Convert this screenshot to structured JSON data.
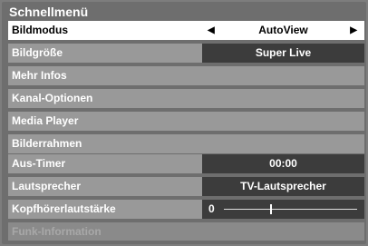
{
  "menu": {
    "title": "Schnellmenü",
    "rows": [
      {
        "label": "Bildmodus",
        "value": "AutoView"
      },
      {
        "label": "Bildgröße",
        "value": "Super Live"
      },
      {
        "label": "Mehr Infos"
      },
      {
        "label": "Kanal-Optionen"
      },
      {
        "label": "Media Player"
      },
      {
        "label": "Bilderrahmen"
      },
      {
        "label": "Aus-Timer",
        "value": "00:00"
      },
      {
        "label": "Lautsprecher",
        "value": "TV-Lautsprecher"
      },
      {
        "label": "Kopfhörerlautstärke",
        "value": "0",
        "level": 0.35
      },
      {
        "label": "Funk-Information"
      }
    ]
  },
  "icons": {
    "left": "left-arrow-icon",
    "right": "right-arrow-icon"
  },
  "colors": {
    "background": "#7d7d7d",
    "row": "#999999",
    "selected_row": "#ffffff",
    "value_box": "#3c3c3c"
  }
}
